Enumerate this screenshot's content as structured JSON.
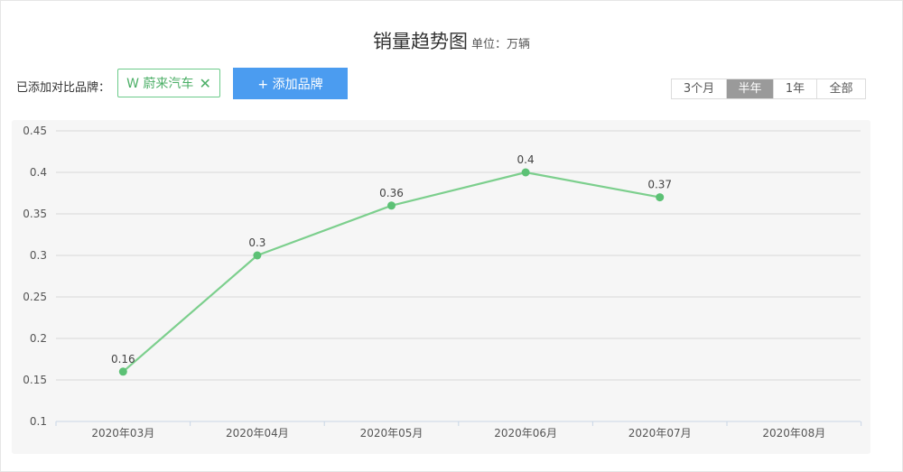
{
  "header": {
    "title": "销量趋势图",
    "unit": "单位：万辆"
  },
  "brands": {
    "label": "已添加对比品牌：",
    "selected": "W 蔚来汽车",
    "remove_icon": "close-icon",
    "add_button": "+ 添加品牌"
  },
  "range": {
    "options": [
      "3个月",
      "半年",
      "1年",
      "全部"
    ],
    "active_index": 1
  },
  "colors": {
    "line": "#7ccf8d",
    "point": "#5cc175",
    "accent": "#4b9cf0"
  },
  "chart_data": {
    "type": "line",
    "categories": [
      "2020年03月",
      "2020年04月",
      "2020年05月",
      "2020年06月",
      "2020年07月",
      "2020年08月"
    ],
    "series": [
      {
        "name": "蔚来汽车",
        "values": [
          0.16,
          0.3,
          0.36,
          0.4,
          0.37,
          null
        ]
      }
    ],
    "yticks": [
      "0.1",
      "0.15",
      "0.2",
      "0.25",
      "0.3",
      "0.35",
      "0.4",
      "0.45"
    ],
    "ylim": [
      0.1,
      0.45
    ],
    "grid": true,
    "data_labels": [
      "0.16",
      "0.3",
      "0.36",
      "0.4",
      "0.37"
    ]
  }
}
